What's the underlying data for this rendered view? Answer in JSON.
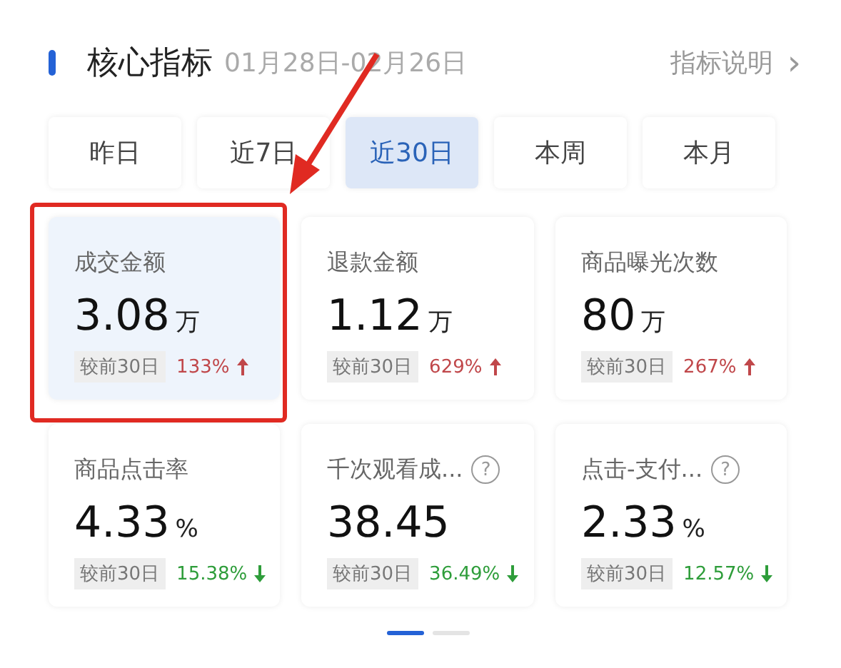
{
  "header": {
    "title": "核心指标",
    "date_range": "01月28日-02月26日",
    "link": "指标说明",
    "link_icon": "›"
  },
  "tabs": [
    {
      "label": "昨日",
      "selected": false
    },
    {
      "label": "近7日",
      "selected": false
    },
    {
      "label": "近30日",
      "selected": true
    },
    {
      "label": "本周",
      "selected": false
    },
    {
      "label": "本月",
      "selected": false
    }
  ],
  "cards": [
    {
      "title": "成交金额",
      "value": "3.08",
      "unit": "万",
      "compare": "较前30日",
      "change": "133%",
      "increase": true,
      "help": false,
      "selected": true
    },
    {
      "title": "退款金额",
      "value": "1.12",
      "unit": "万",
      "compare": "较前30日",
      "change": "629%",
      "increase": true,
      "help": false,
      "selected": false
    },
    {
      "title": "商品曝光次数",
      "value": "80",
      "unit": "万",
      "compare": "较前30日",
      "change": "267%",
      "increase": true,
      "help": false,
      "selected": false
    },
    {
      "title": "商品点击率",
      "value": "4.33",
      "unit": "%",
      "compare": "较前30日",
      "change": "15.38%",
      "increase": false,
      "help": false,
      "selected": false
    },
    {
      "title": "千次观看成...",
      "value": "38.45",
      "compare": "较前30日",
      "change": "36.49%",
      "increase": false,
      "help": true,
      "help_icon": "?",
      "selected": false
    },
    {
      "title": "点击-支付...",
      "value": "2.33",
      "unit": "%",
      "compare": "较前30日",
      "change": "12.57%",
      "increase": false,
      "help": true,
      "help_icon": "?",
      "selected": false
    }
  ],
  "pages": [
    {
      "selected": true
    },
    {
      "selected": false
    }
  ],
  "annotation": {
    "highlight": true,
    "arrow": true
  }
}
